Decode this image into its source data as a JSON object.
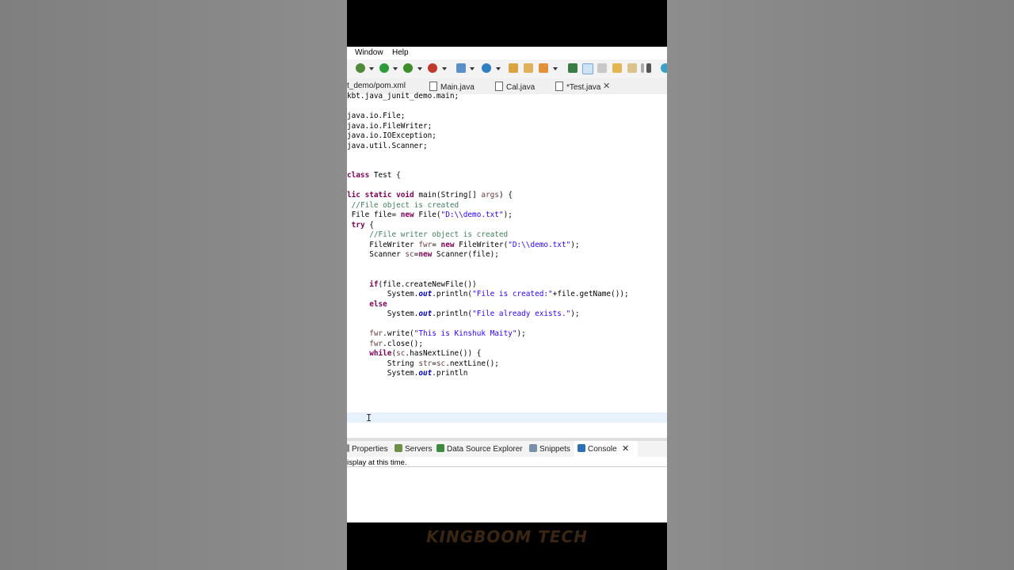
{
  "menu": [
    "Window",
    "Help"
  ],
  "editor_tabs": [
    {
      "label": "t_demo/pom.xml"
    },
    {
      "label": "Main.java"
    },
    {
      "label": "Cal.java"
    },
    {
      "label": "*Test.java",
      "active": true
    }
  ],
  "code_lines": [
    "kbt.java_junit_demo.main;",
    "",
    "java.io.File;",
    "java.io.FileWriter;",
    "java.io.IOException;",
    "java.util.Scanner;",
    "",
    "",
    "class Test {",
    "",
    "lic static void main(String[] args) {",
    " //File object is created",
    " File file= new File(\"D:\\\\demo.txt\");",
    " try {",
    "     //File writer object is created",
    "     FileWriter fwr= new FileWriter(\"D:\\\\demo.txt\");",
    "     Scanner sc=new Scanner(file);",
    "",
    "",
    "     if(file.createNewFile())",
    "         System.out.println(\"File is created:\"+file.getName());",
    "     else",
    "         System.out.println(\"File already exists.\");",
    "",
    "     fwr.write(\"This is Kinshuk Maity\");",
    "     fwr.close();",
    "     while(sc.hasNextLine()) {",
    "         String str=sc.nextLine();",
    "         System.out.println"
  ],
  "view_tabs": [
    "Properties",
    "Servers",
    "Data Source Explorer",
    "Snippets",
    "Console"
  ],
  "console_text": "isplay at this time.",
  "watermark": "KINGBOOM TECH",
  "colors": {
    "keyword": "#7f0055",
    "comment": "#3f7f5f",
    "string": "#2a00ff",
    "field": "#0000c0"
  }
}
